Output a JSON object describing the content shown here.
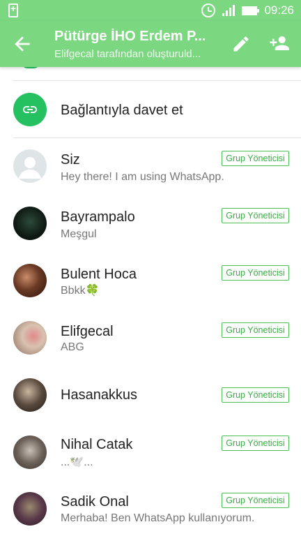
{
  "status_bar": {
    "time": "09:26"
  },
  "header": {
    "title": "Pütürge İHO Erdem P...",
    "subtitle": "Elifgecal tarafından oluşturuld..."
  },
  "invite": {
    "label": "Bağlantıyla davet et"
  },
  "badge_label": "Grup Yöneticisi",
  "members": [
    {
      "name": "Siz",
      "status": "Hey there! I am using WhatsApp."
    },
    {
      "name": "Bayrampalo",
      "status": "Meşgul"
    },
    {
      "name": "Bulent Hoca",
      "status": "Bbkk🍀"
    },
    {
      "name": "Elifgecal",
      "status": "ABG"
    },
    {
      "name": "Hasanakkus",
      "status": ""
    },
    {
      "name": "Nihal Catak",
      "status": "...🕊️..."
    },
    {
      "name": "Sadik Onal",
      "status": "Merhaba! Ben WhatsApp kullanıyorum."
    }
  ],
  "colors": {
    "accent": "#7bd881",
    "whatsapp_green": "#25c060",
    "badge": "#4cbf55"
  }
}
